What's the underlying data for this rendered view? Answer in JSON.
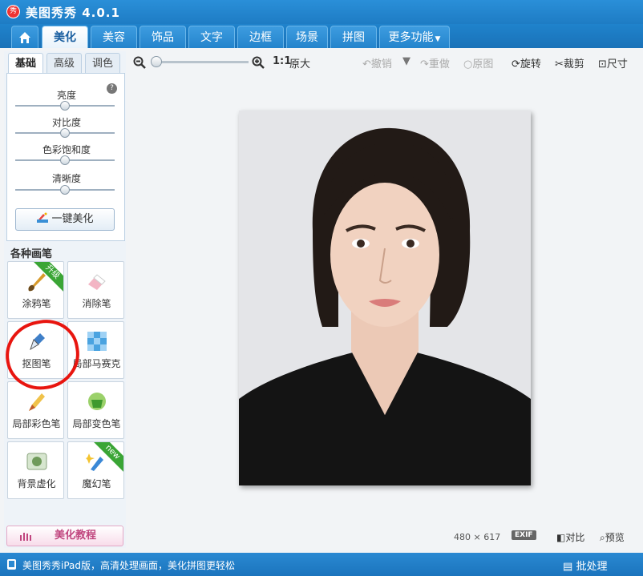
{
  "app": {
    "logo_char": "秀",
    "title": "美图秀秀 4.0.1"
  },
  "tabs": [
    {
      "label": "美化",
      "active": true
    },
    {
      "label": "美容"
    },
    {
      "label": "饰品"
    },
    {
      "label": "文字"
    },
    {
      "label": "边框"
    },
    {
      "label": "场景"
    },
    {
      "label": "拼图"
    },
    {
      "label": "更多功能"
    }
  ],
  "subtabs": [
    "基础",
    "高级",
    "调色"
  ],
  "sliders": [
    {
      "label": "亮度",
      "level": 0.5
    },
    {
      "label": "对比度",
      "level": 0.5
    },
    {
      "label": "色彩饱和度",
      "level": 0.5
    },
    {
      "label": "清晰度",
      "level": 0.5
    }
  ],
  "onekey_label": "一键美化",
  "brushes_title": "各种画笔",
  "brushes": [
    {
      "label": "涂鸦笔",
      "badge": "升级"
    },
    {
      "label": "消除笔"
    },
    {
      "label": "抠图笔"
    },
    {
      "label": "局部马赛克"
    },
    {
      "label": "局部彩色笔"
    },
    {
      "label": "局部变色笔"
    },
    {
      "label": "背景虚化"
    },
    {
      "label": "魔幻笔",
      "badge": "new"
    }
  ],
  "tutorial_label": "美化教程",
  "toolbar": {
    "ratio_label": "1:1",
    "original_size": "原大",
    "undo": "撤销",
    "redo": "重做",
    "original": "原图",
    "rotate": "旋转",
    "crop": "裁剪",
    "size": "尺寸"
  },
  "image": {
    "width": "480",
    "times": "×",
    "height": "617",
    "exif": "EXIF"
  },
  "status": {
    "compare": "对比",
    "preview": "预览"
  },
  "bottom": {
    "message": "美图秀秀iPad版，高清处理画面，美化拼图更轻松",
    "batch": "批处理"
  },
  "colors": {
    "title_blue": "#1e7cc4",
    "active_tab_text": "#1a5fa0",
    "annotation_red": "#e8150f",
    "badge_green": "#3aa535"
  }
}
